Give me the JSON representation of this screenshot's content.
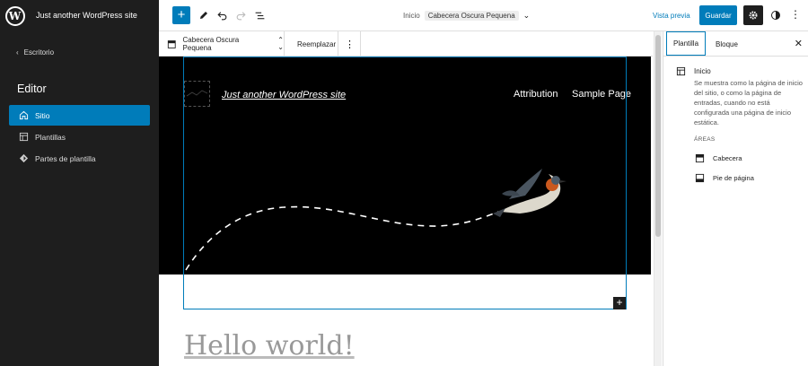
{
  "sidebar": {
    "site_title": "Just another WordPress site",
    "back_label": "Escritorio",
    "heading": "Editor",
    "items": [
      {
        "label": "Sitio",
        "icon": "home-icon",
        "active": true
      },
      {
        "label": "Plantillas",
        "icon": "layout-icon",
        "active": false
      },
      {
        "label": "Partes de plantilla",
        "icon": "symbol-icon",
        "active": false
      }
    ]
  },
  "topbar": {
    "doc_prefix": "Inicio",
    "doc_part": "Cabecera Oscura Pequena",
    "preview_label": "Vista previa",
    "save_label": "Guardar"
  },
  "block_toolbar": {
    "block_name": "Cabecera Oscura Pequena",
    "replace_label": "Reemplazar"
  },
  "canvas": {
    "site_link": "Just another WordPress site",
    "nav_items": [
      "Attribution",
      "Sample Page"
    ],
    "post_title": "Hello world!"
  },
  "panel": {
    "tabs": [
      "Plantilla",
      "Bloque"
    ],
    "active_tab": "Plantilla",
    "template_name": "Inicio",
    "template_description": "Se muestra como la página de inicio del sitio, o como la página de entradas, cuando no está configurada una página de inicio estática.",
    "areas_heading": "ÁREAS",
    "areas": [
      "Cabecera",
      "Pie de página"
    ]
  },
  "colors": {
    "accent": "#007cba",
    "sidebar_bg": "#1e1e1e",
    "header_bg": "#000000"
  }
}
